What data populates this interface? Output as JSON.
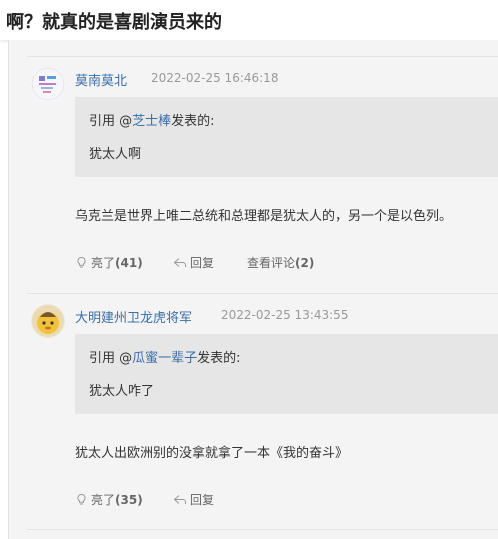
{
  "page_title": "啊？就真的是喜剧演员来的",
  "posts": [
    {
      "author": "莫南莫北",
      "time": "2022-02-25 16:46:18",
      "quote_prefix": "引用 @",
      "quote_user": "芝士棒",
      "quote_suffix": "发表的:",
      "quote_text": "犹太人啊",
      "content": "乌克兰是世界上唯二总统和总理都是犹太人的，另一个是以色列。",
      "like_label": "亮了",
      "like_count": "(41)",
      "reply_label": "回复",
      "view_comments_label": "查看评论",
      "view_comments_count": "(2)"
    },
    {
      "author": "大明建州卫龙虎将军",
      "time": "2022-02-25 13:43:55",
      "quote_prefix": "引用 @",
      "quote_user": "瓜蜜一辈子",
      "quote_suffix": "发表的:",
      "quote_text": "犹太人咋了",
      "content": "犹太人出欧洲别的没拿就拿了一本《我的奋斗》",
      "like_label": "亮了",
      "like_count": "(35)",
      "reply_label": "回复"
    }
  ],
  "colors": {
    "link": "#3a6ea8",
    "quote_bg": "#e6e6e6",
    "thread_bg": "#f4f4f4"
  }
}
